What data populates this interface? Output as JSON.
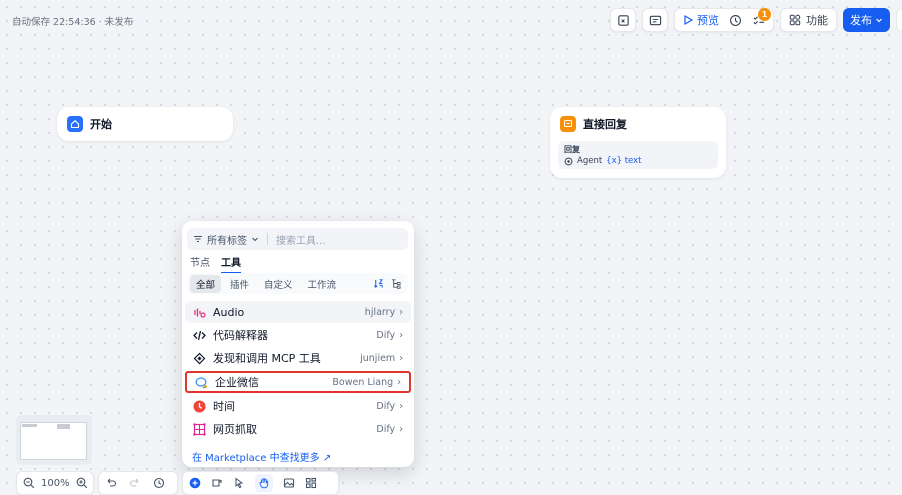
{
  "header": {
    "autosave": "自动保存 22:54:36 · 未发布"
  },
  "toolbar": {
    "preview": "预览",
    "badge_count": "1",
    "features": "功能",
    "publish": "发布"
  },
  "nodes": {
    "start": {
      "title": "开始"
    },
    "reply": {
      "title": "直接回复",
      "box_title": "回复",
      "agent": "Agent",
      "var": "{x} text"
    }
  },
  "panel": {
    "filter_label": "所有标签",
    "search_placeholder": "搜索工具...",
    "tabs": [
      "节点",
      "工具"
    ],
    "categories": [
      "全部",
      "插件",
      "自定义",
      "工作流"
    ],
    "tools": [
      {
        "name": "Audio",
        "author": "hjlarry",
        "icon": "audio-icon"
      },
      {
        "name": "代码解释器",
        "author": "Dify",
        "icon": "code-icon"
      },
      {
        "name": "发现和调用 MCP 工具",
        "author": "junjiem",
        "icon": "mcp-icon"
      },
      {
        "name": "企业微信",
        "author": "Bowen Liang",
        "icon": "wecom-icon"
      },
      {
        "name": "时间",
        "author": "Dify",
        "icon": "clock-icon"
      },
      {
        "name": "网页抓取",
        "author": "Dify",
        "icon": "webscraper-icon"
      }
    ],
    "marketplace_link": "在 Marketplace 中查找更多 ↗"
  },
  "zoom": {
    "level": "100%"
  },
  "colors": {
    "accent": "#155eef",
    "selection_outline": "#e0352b",
    "badge": "#f79009"
  }
}
